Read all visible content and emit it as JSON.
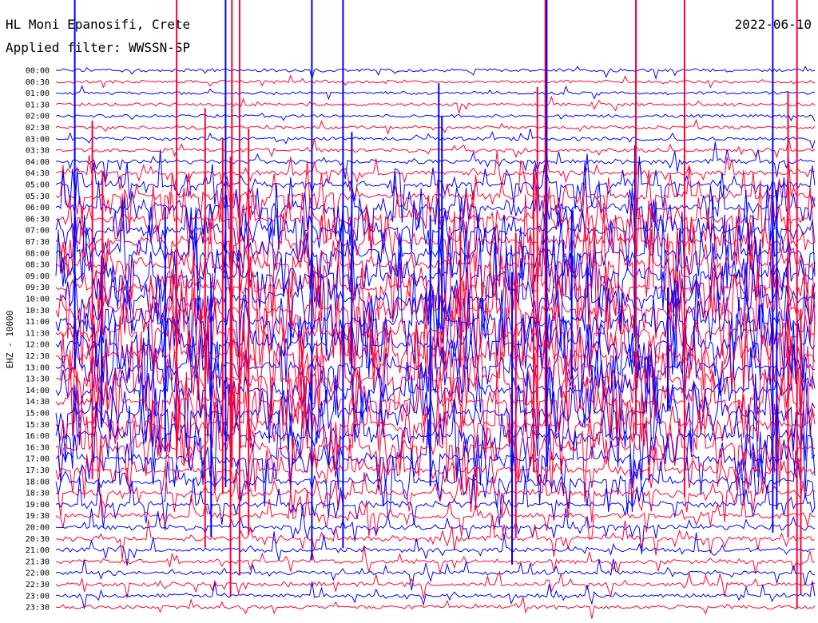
{
  "header": {
    "station": "HL Moni Epanosifi, Crete",
    "filter": "Applied filter: WWSSN-SP",
    "date": "2022-06-10"
  },
  "chart_data": {
    "type": "helicorder",
    "channel_label": "EHZ - 10000",
    "row_labels": [
      "00:00",
      "00:30",
      "01:00",
      "01:30",
      "02:00",
      "02:30",
      "03:00",
      "03:30",
      "04:00",
      "04:30",
      "05:00",
      "05:30",
      "06:00",
      "06:30",
      "07:00",
      "07:30",
      "08:00",
      "08:30",
      "09:00",
      "09:30",
      "10:00",
      "10:30",
      "11:00",
      "11:30",
      "12:00",
      "12:30",
      "13:00",
      "13:30",
      "14:00",
      "14:30",
      "15:00",
      "15:30",
      "16:00",
      "16:30",
      "17:00",
      "17:30",
      "18:00",
      "18:30",
      "19:00",
      "19:30",
      "20:00",
      "20:30",
      "21:00",
      "21:30",
      "22:00",
      "22:30",
      "23:00",
      "23:30"
    ],
    "activity": [
      0.15,
      0.12,
      0.12,
      0.14,
      0.1,
      0.12,
      0.18,
      0.25,
      0.3,
      0.35,
      0.6,
      0.65,
      0.7,
      0.75,
      0.8,
      0.85,
      0.9,
      0.9,
      0.95,
      0.95,
      1.0,
      1.0,
      1.0,
      1.0,
      1.0,
      1.0,
      1.0,
      1.0,
      0.95,
      0.95,
      0.9,
      0.85,
      0.9,
      0.95,
      0.85,
      0.7,
      0.6,
      0.55,
      0.5,
      0.45,
      0.4,
      0.35,
      0.3,
      0.3,
      0.25,
      0.25,
      0.25,
      0.2
    ],
    "colors": [
      "#0000ff",
      "#ff0033"
    ]
  }
}
